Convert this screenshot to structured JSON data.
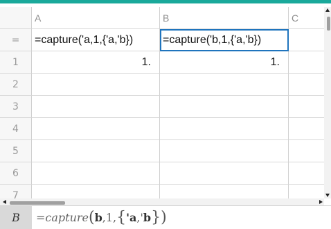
{
  "columns": [
    "A",
    "B",
    "C"
  ],
  "formula_row_symbol": "=",
  "formulas": {
    "A": "=capture('a,1,{'a,'b})",
    "B": "=capture('b,1,{'a,'b})"
  },
  "rows": [
    {
      "n": "1",
      "A": "1.",
      "B": "1."
    },
    {
      "n": "2",
      "A": "",
      "B": ""
    },
    {
      "n": "3",
      "A": "",
      "B": ""
    },
    {
      "n": "4",
      "A": "",
      "B": ""
    },
    {
      "n": "5",
      "A": "",
      "B": ""
    },
    {
      "n": "6",
      "A": "",
      "B": ""
    },
    {
      "n": "7",
      "A": "",
      "B": ""
    }
  ],
  "entry_line": {
    "cell_label": "B",
    "eq": "=",
    "func": "capture",
    "open": "(",
    "arg1": "b",
    "comma1": ",1,",
    "lbrace": "{",
    "set_a": "'a",
    "set_sep": ",'",
    "set_b": "b",
    "rbrace": "}",
    "close": ")"
  },
  "colors": {
    "accent_top": "#1aa99b",
    "selection": "#1f74bd"
  }
}
